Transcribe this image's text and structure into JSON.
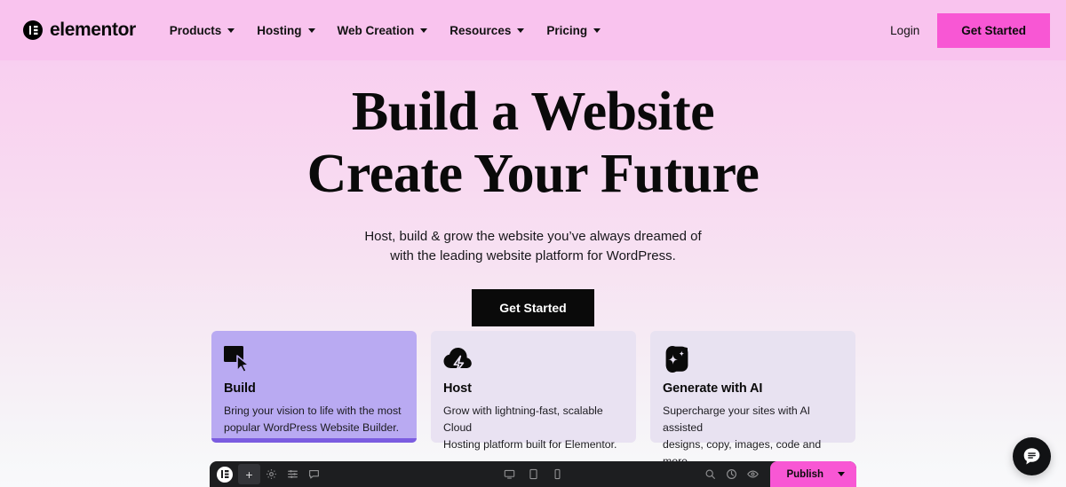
{
  "header": {
    "logo_text": "elementor",
    "nav": [
      {
        "label": "Products"
      },
      {
        "label": "Hosting"
      },
      {
        "label": "Web Creation"
      },
      {
        "label": "Resources"
      },
      {
        "label": "Pricing"
      }
    ],
    "login_label": "Login",
    "get_started_label": "Get Started",
    "accent_pink": "#f857d4",
    "bar_background": "#f9c3ee"
  },
  "hero": {
    "title_line1": "Build a Website",
    "title_line2": "Create Your Future",
    "sub_line1": "Host, build & grow the website you’ve always dreamed of",
    "sub_line2": "with the leading website platform for WordPress.",
    "cta_label": "Get Started",
    "cta_background": "#0a0a0a"
  },
  "cards": [
    {
      "icon": "cursor-square-icon",
      "title": "Build",
      "desc_line1": "Bring your vision to life with the most",
      "desc_line2": "popular WordPress Website Builder.",
      "background": "#b9aaf2",
      "active": true
    },
    {
      "icon": "cloud-bolt-icon",
      "title": "Host",
      "desc_line1": "Grow with lightning-fast, scalable Cloud",
      "desc_line2": "Hosting platform built for Elementor.",
      "background": "#e9e2f2",
      "active": false
    },
    {
      "icon": "ai-sparkle-icon",
      "title": "Generate with AI",
      "desc_line1": "Supercharge your sites with AI assisted",
      "desc_line2": "designs, copy, images, code and more.",
      "background": "#e8e2f1",
      "active": false
    }
  ],
  "editor_toolbar": {
    "background": "#1d1e20",
    "logo": "elementor-mark-icon",
    "add_label": "+",
    "left_tools": [
      {
        "icon": "settings-gear-icon"
      },
      {
        "icon": "navigator-structure-icon"
      },
      {
        "icon": "comments-bubble-icon"
      }
    ],
    "devices": [
      {
        "icon": "desktop-icon",
        "label": "Desktop"
      },
      {
        "icon": "tablet-icon",
        "label": "Tablet"
      },
      {
        "icon": "mobile-icon",
        "label": "Mobile"
      }
    ],
    "right_tools": [
      {
        "icon": "search-icon"
      },
      {
        "icon": "history-icon"
      },
      {
        "icon": "preview-eye-icon"
      }
    ],
    "publish_label": "Publish",
    "publish_background": "#f857d4"
  },
  "chat_widget": {
    "icon": "chat-bubble-icon",
    "background": "#111214"
  }
}
